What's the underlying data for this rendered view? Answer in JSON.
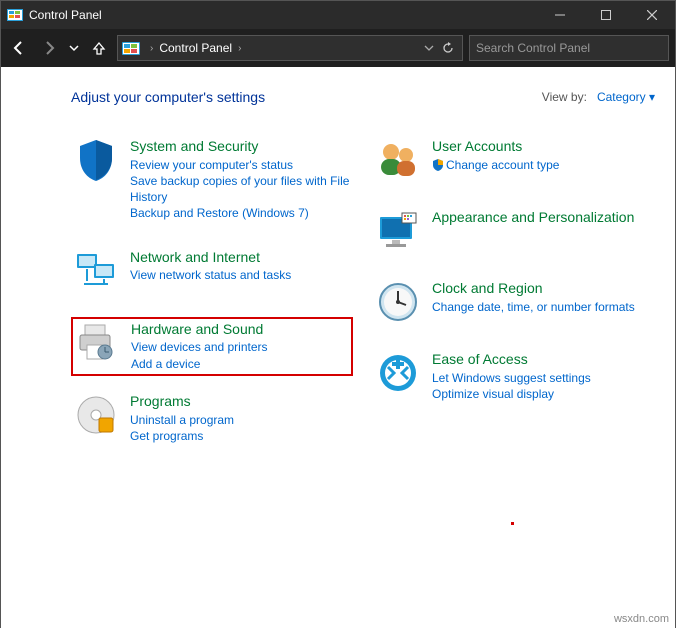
{
  "window": {
    "title": "Control Panel"
  },
  "address": {
    "location": "Control Panel"
  },
  "search": {
    "placeholder": "Search Control Panel"
  },
  "heading": "Adjust your computer's settings",
  "viewby": {
    "label": "View by:",
    "value": "Category"
  },
  "left": [
    {
      "title": "System and Security",
      "links": [
        "Review your computer's status",
        "Save backup copies of your files with File History",
        "Backup and Restore (Windows 7)"
      ]
    },
    {
      "title": "Network and Internet",
      "links": [
        "View network status and tasks"
      ]
    },
    {
      "title": "Hardware and Sound",
      "links": [
        "View devices and printers",
        "Add a device"
      ]
    },
    {
      "title": "Programs",
      "links": [
        "Uninstall a program",
        "Get programs"
      ]
    }
  ],
  "right": [
    {
      "title": "User Accounts",
      "links": [
        "Change account type"
      ],
      "shield": true
    },
    {
      "title": "Appearance and Personalization",
      "links": []
    },
    {
      "title": "Clock and Region",
      "links": [
        "Change date, time, or number formats"
      ]
    },
    {
      "title": "Ease of Access",
      "links": [
        "Let Windows suggest settings",
        "Optimize visual display"
      ]
    }
  ],
  "watermark": "wsxdn.com"
}
